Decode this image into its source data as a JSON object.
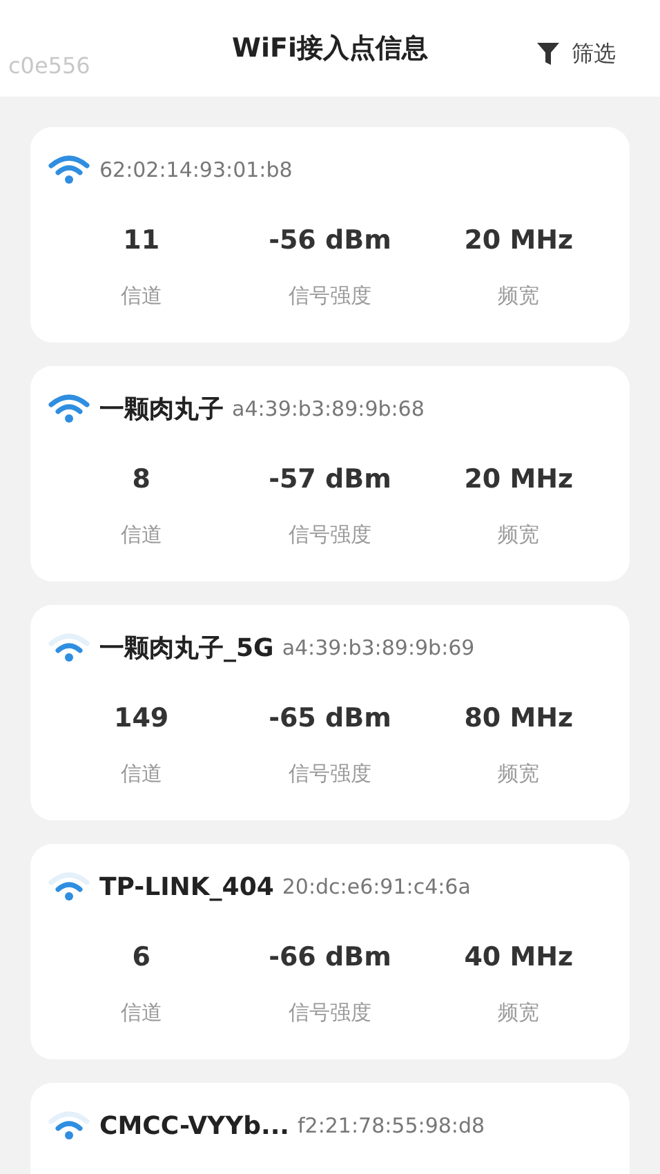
{
  "header": {
    "left_text": "c0e556",
    "title": "WiFi接入点信息",
    "filter_button": "筛选"
  },
  "access_points": [
    {
      "kind": "strong",
      "bssid": "62:02:14:93:01:b8",
      "channel": "11",
      "strength": "-56 dBm",
      "bandwidth": "20 MHz",
      "channel_label": "信道",
      "strength_label": "信号强度",
      "bandwidth_label": "频宽"
    },
    {
      "kind": "strong",
      "ssid": "一颗肉丸子",
      "bssid": "a4:39:b3:89:9b:68",
      "channel": "8",
      "strength": "-57 dBm",
      "bandwidth": "20 MHz",
      "channel_label": "信道",
      "strength_label": "信号强度",
      "bandwidth_label": "频宽"
    },
    {
      "kind": "medium",
      "ssid": "一颗肉丸子_5G",
      "bssid": "a4:39:b3:89:9b:69",
      "channel": "149",
      "strength": "-65 dBm",
      "bandwidth": "80 MHz",
      "channel_label": "信道",
      "strength_label": "信号强度",
      "bandwidth_label": "频宽"
    },
    {
      "kind": "medium",
      "ssid": "TP-LINK_404",
      "bssid": "20:dc:e6:91:c4:6a",
      "channel": "6",
      "strength": "-66 dBm",
      "bandwidth": "40 MHz",
      "channel_label": "信道",
      "strength_label": "信号强度",
      "bandwidth_label": "频宽"
    },
    {
      "kind": "medium",
      "ssid": "CMCC-VYYb...",
      "bssid": "f2:21:78:55:98:d8"
    }
  ]
}
